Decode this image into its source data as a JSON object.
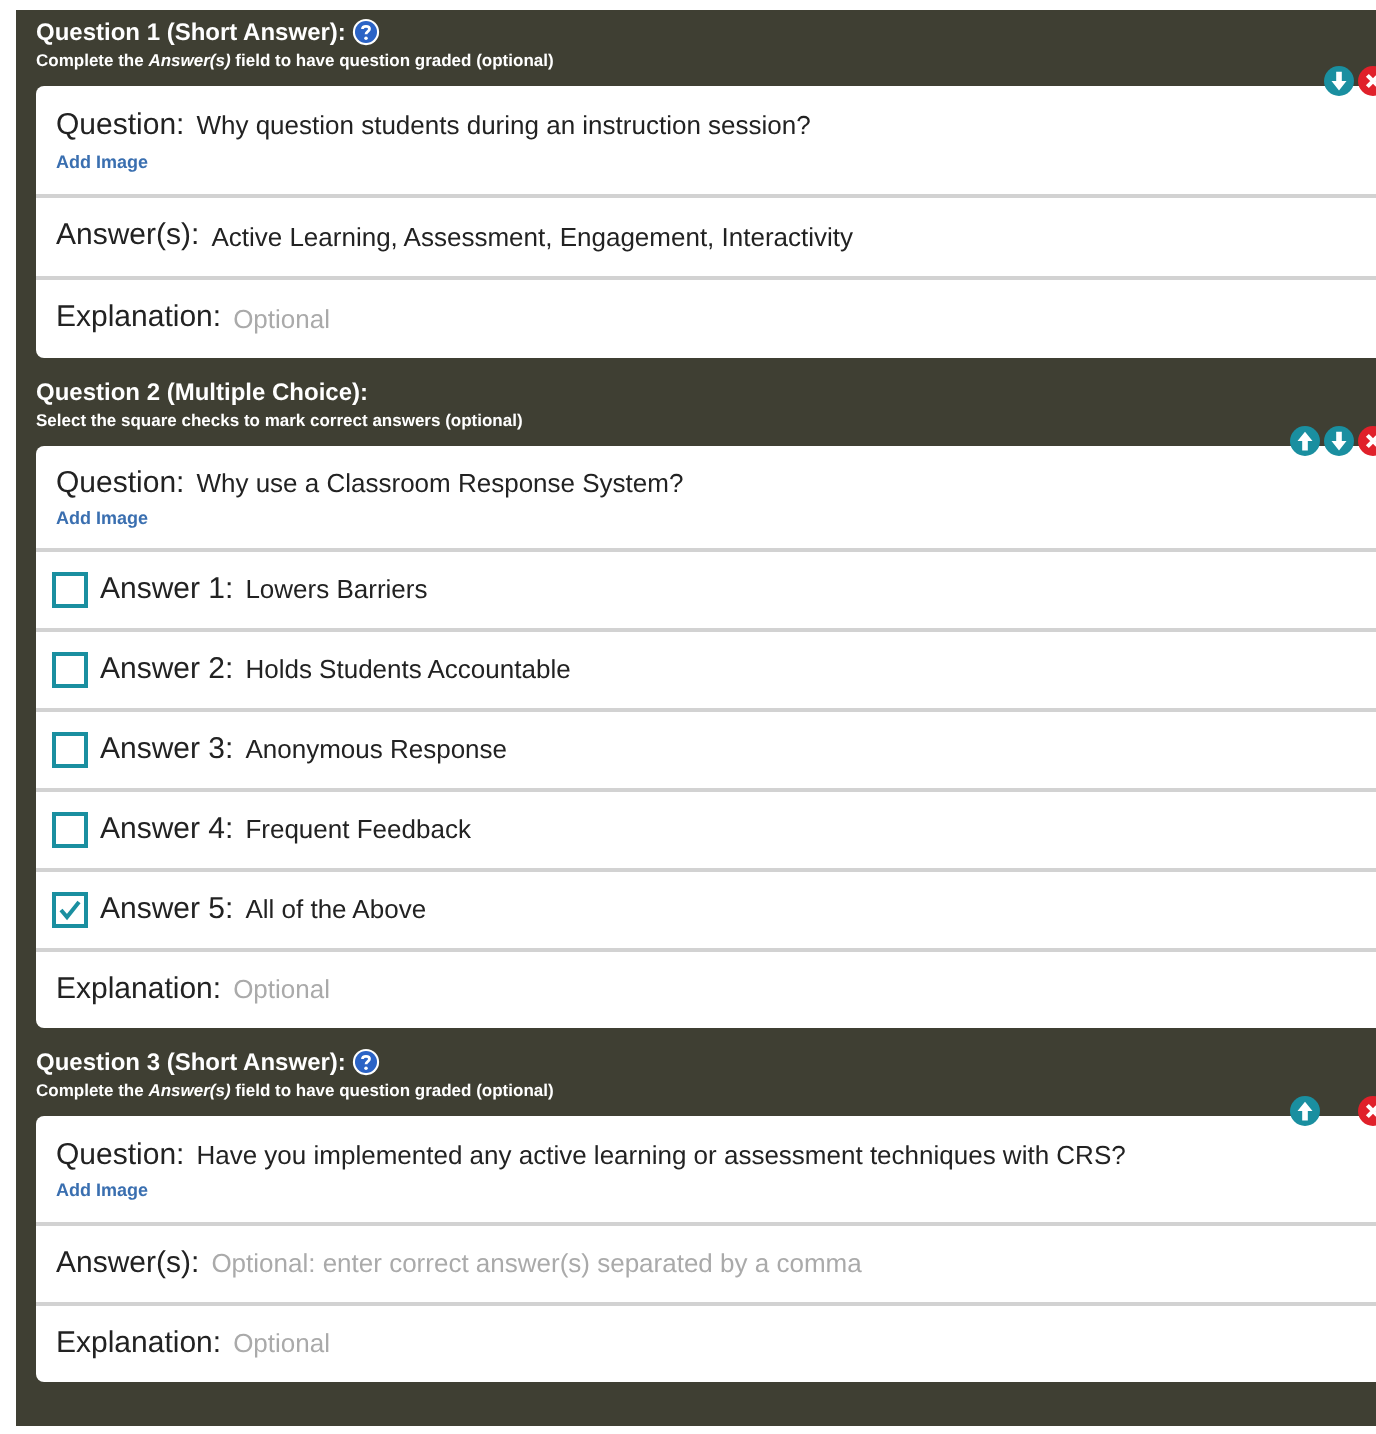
{
  "questions": [
    {
      "kind": "short",
      "title": "Question 1 (Short Answer):",
      "hint": "Complete the *Answer(s)* field to have question graded (optional)",
      "can_move_up": false,
      "can_move_down": true,
      "question": {
        "label": "Question:",
        "value": "Why question students during an instruction session?",
        "link": "Add Image"
      },
      "answer_field": {
        "label": "Answer(s):",
        "value": "Active Learning, Assessment, Engagement, Interactivity"
      },
      "explanation": {
        "label": "Explanation:",
        "placeholder": "Optional"
      }
    },
    {
      "kind": "multiple",
      "title": "Question 2 (Multiple Choice):",
      "hint": "Select the square checks to mark correct answers (optional)",
      "can_move_up": true,
      "can_move_down": true,
      "question": {
        "label": "Question:",
        "value": "Why use a Classroom Response System?",
        "link": "Add Image"
      },
      "answers": [
        {
          "label": "Answer 1:",
          "value": "Lowers Barriers",
          "checked": false
        },
        {
          "label": "Answer 2:",
          "value": "Holds Students Accountable",
          "checked": false
        },
        {
          "label": "Answer 3:",
          "value": "Anonymous Response",
          "checked": false
        },
        {
          "label": "Answer 4:",
          "value": "Frequent Feedback",
          "checked": false
        },
        {
          "label": "Answer 5:",
          "value": "All of the Above",
          "checked": true
        }
      ],
      "explanation": {
        "label": "Explanation:",
        "placeholder": "Optional"
      }
    },
    {
      "kind": "short",
      "title": "Question 3 (Short Answer):",
      "hint": "Complete the *Answer(s)* field to have question graded (optional)",
      "can_move_up": true,
      "can_move_down": false,
      "question": {
        "label": "Question:",
        "value": "Have you implemented any active learning or assessment techniques with CRS?",
        "link": "Add Image"
      },
      "answer_field": {
        "label": "Answer(s):",
        "placeholder": "Optional: enter correct answer(s) separated by a comma"
      },
      "explanation": {
        "label": "Explanation:",
        "placeholder": "Optional"
      }
    }
  ]
}
